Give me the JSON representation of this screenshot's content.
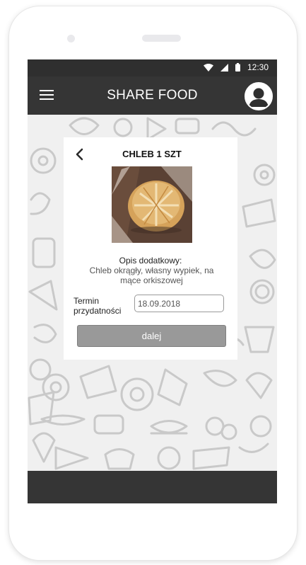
{
  "status_bar": {
    "time": "12:30",
    "icons": [
      "wifi-icon",
      "signal-icon",
      "battery-icon"
    ]
  },
  "app_bar": {
    "title": "SHARE FOOD",
    "menu_icon": "hamburger-menu-icon",
    "profile_icon": "user-avatar-icon"
  },
  "card": {
    "back_icon": "chevron-left-icon",
    "title": "CHLEB 1 SZT",
    "image": "bread-loaf-photo",
    "description_heading": "Opis dodatkowy:",
    "description_text": "Chleb okrągły, własny wypiek, na mące orkiszowej",
    "expiry_label": "Termin przydatności",
    "expiry_value": "18.09.2018",
    "next_button": "dalej"
  },
  "colors": {
    "bar": "#353535",
    "status_bar": "#2f2f2f",
    "button": "#999999",
    "pattern_stroke": "#c9c9c9"
  }
}
